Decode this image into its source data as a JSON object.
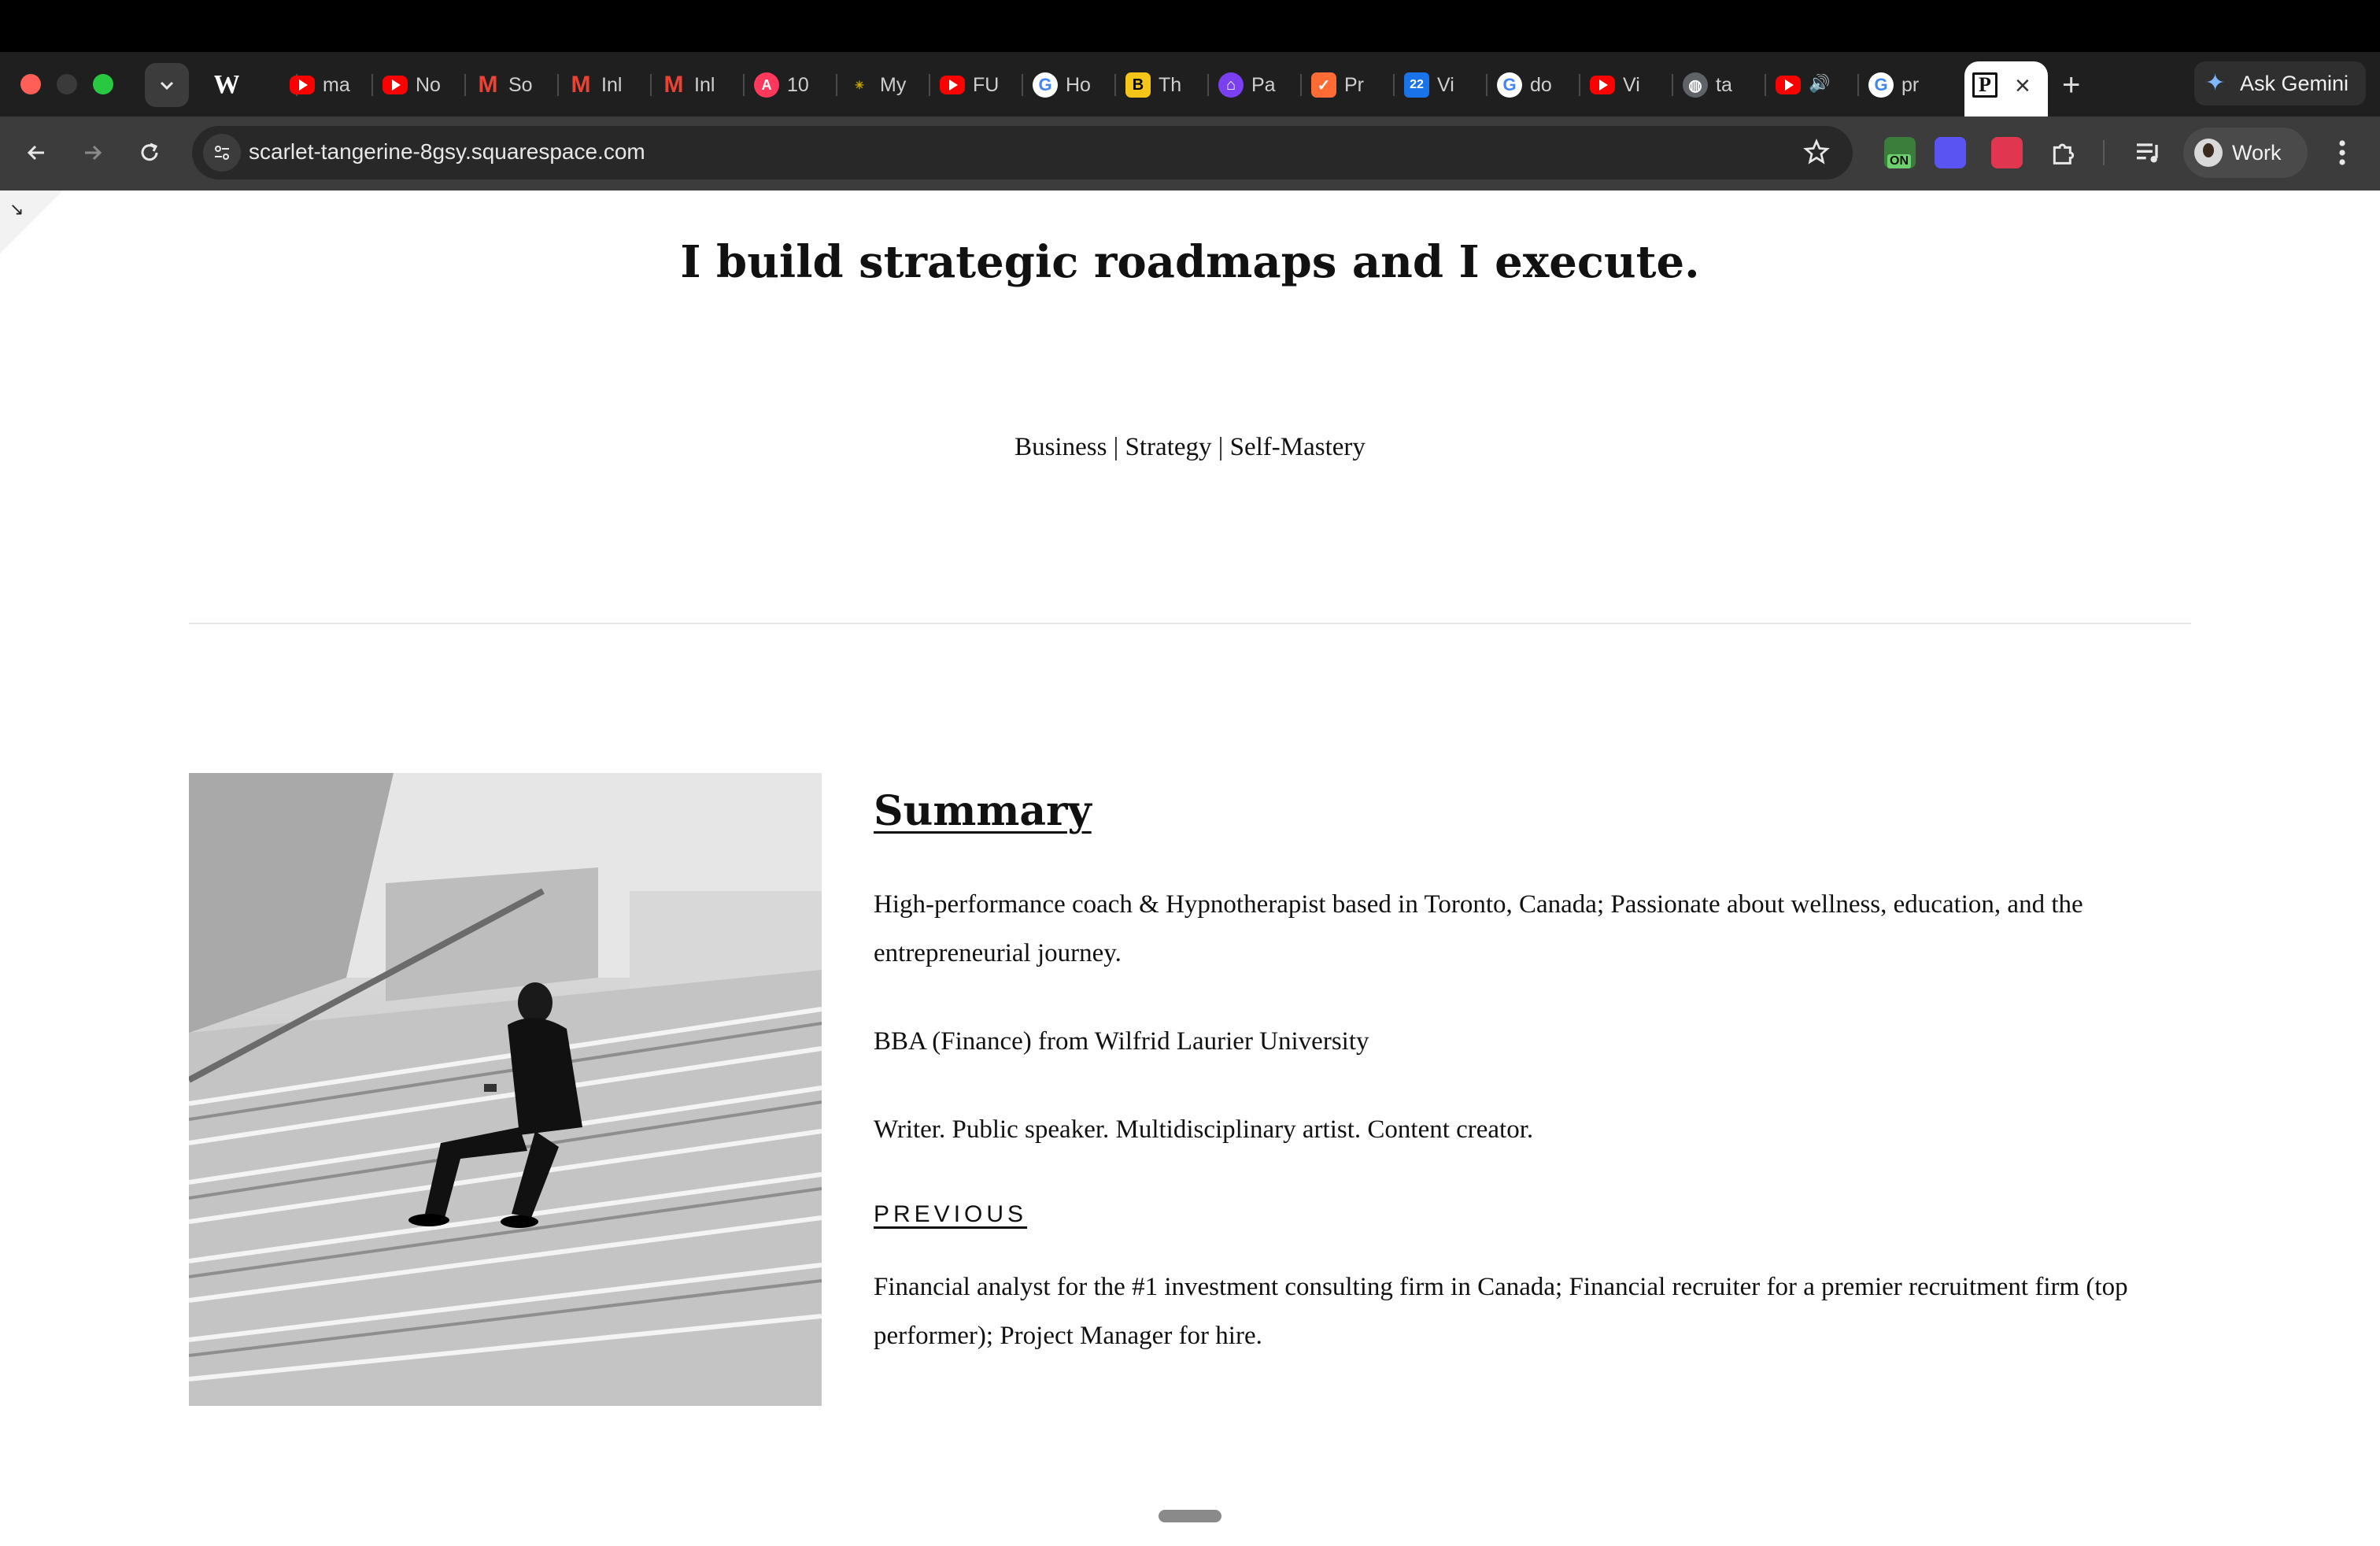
{
  "browser": {
    "tabs": [
      {
        "favicon": "wikipedia-icon",
        "title": "W"
      },
      {
        "favicon": "youtube-icon",
        "title": "ma"
      },
      {
        "favicon": "youtube-icon",
        "title": "No"
      },
      {
        "favicon": "gmail-icon",
        "title": "So"
      },
      {
        "favicon": "gmail-icon",
        "title": "Inl"
      },
      {
        "favicon": "gmail-icon",
        "title": "Inl"
      },
      {
        "favicon": "airbnb-icon",
        "title": "10"
      },
      {
        "favicon": "site-icon",
        "title": "My"
      },
      {
        "favicon": "youtube-icon",
        "title": "FU"
      },
      {
        "favicon": "google-icon",
        "title": "Ho"
      },
      {
        "favicon": "yellow-app-icon",
        "title": "Th"
      },
      {
        "favicon": "purple-app-icon",
        "title": "Pa"
      },
      {
        "favicon": "orange-app-icon",
        "title": "Pr"
      },
      {
        "favicon": "calendar-icon",
        "title": "Vi"
      },
      {
        "favicon": "google-icon",
        "title": "do"
      },
      {
        "favicon": "youtube-icon",
        "title": "Vi"
      },
      {
        "favicon": "globe-icon",
        "title": "ta"
      },
      {
        "favicon": "youtube-audio-icon",
        "title": ""
      },
      {
        "favicon": "google-icon",
        "title": "pr"
      }
    ],
    "active_tab_favicon": "P",
    "ask_gemini_label": "Ask Gemini",
    "url": "scarlet-tangerine-8gsy.squarespace.com",
    "profile_label": "Work",
    "extension_badge": "ON"
  },
  "page": {
    "hero_title": "I build strategic roadmaps and I execute.",
    "tagline": "Business | Strategy | Self-Mastery",
    "summary": {
      "heading": "Summary",
      "p1": "High-performance coach & Hypnotherapist based in Toronto, Canada; Passionate about wellness, education, and the entrepreneurial journey.",
      "p2": "BBA (Finance) from Wilfrid Laurier University",
      "p3": "Writer. Public speaker. Multidisciplinary artist. Content creator.",
      "previous_label": "PREVIOUS",
      "p4": "Financial analyst for the #1 investment consulting firm in Canada; Financial recruiter for a premier recruitment firm (top performer); Project Manager for hire."
    }
  },
  "colors": {
    "chrome_dark": "#1f1f1f",
    "toolbar": "#3c3c3c",
    "text": "#111111"
  }
}
